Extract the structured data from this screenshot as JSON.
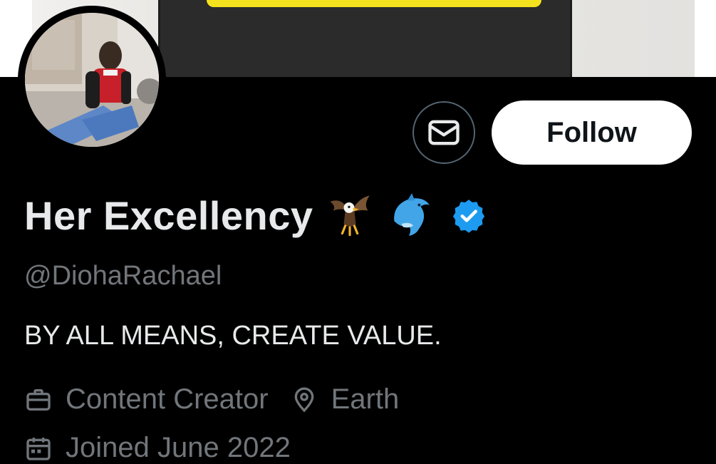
{
  "profile": {
    "display_name": "Her Excellency",
    "emojis": [
      "eagle-emoji",
      "dolphin-emoji"
    ],
    "verified": true,
    "handle": "@DiohaRachael",
    "bio": "BY ALL MEANS, CREATE VALUE.",
    "profession": "Content Creator",
    "location": "Earth",
    "joined": "Joined June 2022"
  },
  "actions": {
    "message_icon": "envelope-icon",
    "follow_label": "Follow"
  },
  "colors": {
    "background": "#000000",
    "primary_text": "#e7e9ea",
    "secondary_text": "#71767b",
    "verified_blue": "#1d9bf0",
    "follow_bg": "#ffffff",
    "follow_text": "#0f1419",
    "banner_yellow": "#f5e21e"
  }
}
